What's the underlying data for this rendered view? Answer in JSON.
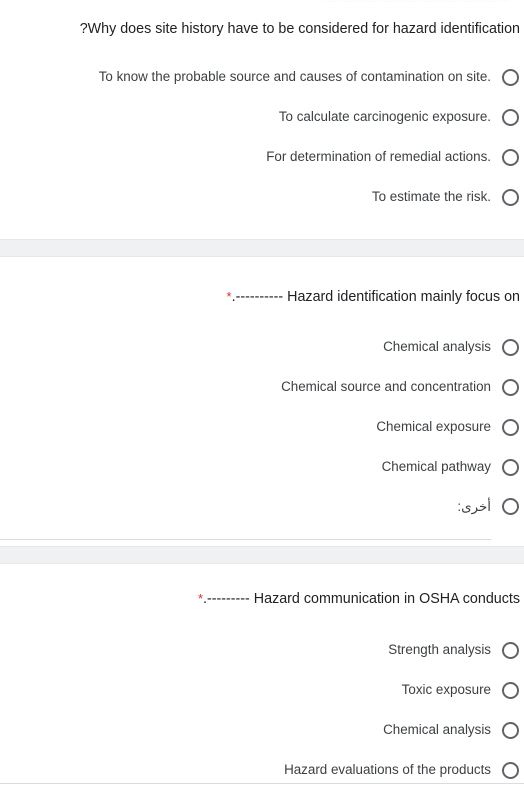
{
  "page": {
    "direction": "rtl",
    "background": "#ffffff",
    "gap_band_color": "#eff1f3",
    "required_star_color": "#d93025",
    "radio_outline_color": "#5f6368",
    "title_color": "#202124",
    "option_color": "#3c4043"
  },
  "questions": [
    {
      "id": "q1",
      "title": "?Why does site history have to be considered for hazard identification",
      "required": false,
      "required_marker": "",
      "options": [
        {
          "label": "To know the probable source and causes of contamination on site.",
          "type": "radio",
          "selected": false
        },
        {
          "label": "To calculate carcinogenic exposure.",
          "type": "radio",
          "selected": false
        },
        {
          "label": "For determination of remedial actions.",
          "type": "radio",
          "selected": false
        },
        {
          "label": "To estimate the risk.",
          "type": "radio",
          "selected": false
        }
      ]
    },
    {
      "id": "q2",
      "title": ".---------- Hazard identification mainly focus on",
      "required": true,
      "required_marker": "*",
      "options": [
        {
          "label": "Chemical analysis",
          "type": "radio",
          "selected": false
        },
        {
          "label": "Chemical source and concentration",
          "type": "radio",
          "selected": false
        },
        {
          "label": "Chemical exposure",
          "type": "radio",
          "selected": false
        },
        {
          "label": "Chemical pathway",
          "type": "radio",
          "selected": false
        }
      ],
      "other_option": {
        "label": "أخرى:",
        "value": "",
        "placeholder": ""
      }
    },
    {
      "id": "q3",
      "title": ".--------- Hazard communication in OSHA conducts",
      "required": true,
      "required_marker": "*",
      "options": [
        {
          "label": "Strength analysis",
          "type": "radio",
          "selected": false
        },
        {
          "label": "Toxic exposure",
          "type": "radio",
          "selected": false
        },
        {
          "label": "Chemical analysis",
          "type": "radio",
          "selected": false
        },
        {
          "label": "Hazard evaluations of the products",
          "type": "radio",
          "selected": false
        }
      ]
    }
  ],
  "ghost_top_text": "........................................................"
}
